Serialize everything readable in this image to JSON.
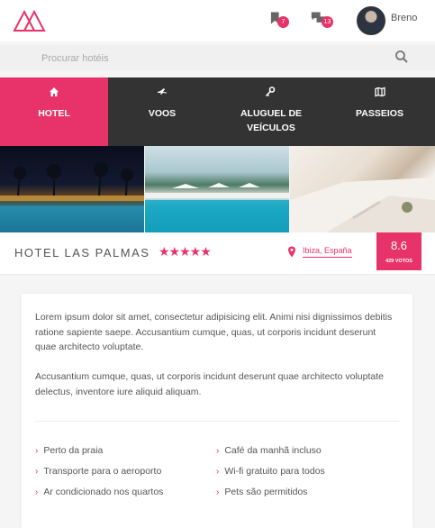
{
  "header": {
    "logo": "mountain-logo",
    "bookmarks_count": "7",
    "messages_count": "13",
    "username": "Breno"
  },
  "search": {
    "placeholder": "Procurar hotéis"
  },
  "tabs": [
    {
      "label": "HOTEL",
      "icon": "home-icon",
      "active": true
    },
    {
      "label": "VOOS",
      "icon": "plane-icon",
      "active": false
    },
    {
      "label": "ALUGUEL DE VEÍCULOS",
      "icon": "key-icon",
      "active": false
    },
    {
      "label": "PASSEIOS",
      "icon": "map-icon",
      "active": false
    }
  ],
  "hotel": {
    "name": "HOTEL LAS PALMAS",
    "stars": "★★★★★",
    "location": "Ibiza, España",
    "score": "8.6",
    "votes": "429 VOTOS"
  },
  "description": {
    "p1": "Lorem ipsum dolor sit amet, consectetur adipisicing elit. Animi nisi dignissimos debitis ratione sapiente saepe. Accusantium cumque, quas, ut corporis incidunt deserunt quae architecto voluptate.",
    "p2": "Accusantium cumque, quas, ut corporis incidunt deserunt quae architecto voluptate delectus, inventore iure aliquid aliquam."
  },
  "amenities": [
    "Perto da praia",
    "Café da manhã incluso",
    "Transporte para o aeroporto",
    "Wi-fi gratuito para todos",
    "Ar condicionado nos quartos",
    "Pets são permitidos"
  ],
  "colors": {
    "accent": "#e8336a",
    "dark": "#333333"
  }
}
